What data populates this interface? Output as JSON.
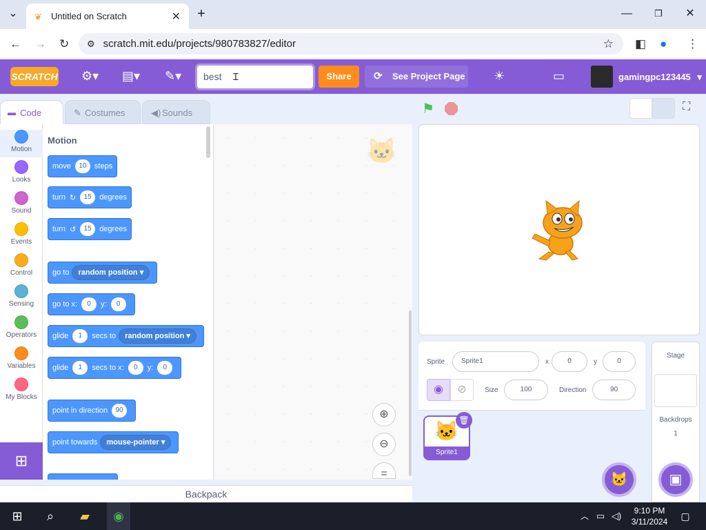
{
  "browser": {
    "tab_title": "Untitled on Scratch",
    "url": "scratch.mit.edu/projects/980783827/editor"
  },
  "menubar": {
    "logo": "SCRATCH",
    "title_value": "best",
    "share_label": "Share",
    "see_project_label": "See Project Page",
    "username": "gamingpc123445"
  },
  "tabs": {
    "code": "Code",
    "costumes": "Costumes",
    "sounds": "Sounds"
  },
  "categories": [
    {
      "label": "Motion",
      "color": "#4c97ff"
    },
    {
      "label": "Looks",
      "color": "#9966ff"
    },
    {
      "label": "Sound",
      "color": "#cf63cf"
    },
    {
      "label": "Events",
      "color": "#ffbf00"
    },
    {
      "label": "Control",
      "color": "#ffab19"
    },
    {
      "label": "Sensing",
      "color": "#5cb1d6"
    },
    {
      "label": "Operators",
      "color": "#59c059"
    },
    {
      "label": "Variables",
      "color": "#ff8c1a"
    },
    {
      "label": "My Blocks",
      "color": "#ff6680"
    }
  ],
  "palette": {
    "section_title": "Motion",
    "move": {
      "a": "move",
      "v": "10",
      "b": "steps"
    },
    "turn_right": {
      "a": "turn",
      "v": "15",
      "b": "degrees"
    },
    "turn_left": {
      "a": "turn",
      "v": "15",
      "b": "degrees"
    },
    "goto": {
      "a": "go to",
      "d": "random position"
    },
    "goto_xy": {
      "a": "go to x:",
      "x": "0",
      "b": "y:",
      "y": "0"
    },
    "glide": {
      "a": "glide",
      "v": "1",
      "b": "secs to",
      "d": "random position"
    },
    "glide_xy": {
      "a": "glide",
      "v": "1",
      "b": "secs to x:",
      "x": "0",
      "c": "y:",
      "y": "0"
    },
    "point_dir": {
      "a": "point in direction",
      "v": "90"
    },
    "point_towards": {
      "a": "point towards",
      "d": "mouse-pointer"
    }
  },
  "backpack": "Backpack",
  "sprite_info": {
    "sprite_label": "Sprite",
    "sprite_name": "Sprite1",
    "x_label": "x",
    "x": "0",
    "y_label": "y",
    "y": "0",
    "size_label": "Size",
    "size": "100",
    "direction_label": "Direction",
    "direction": "90"
  },
  "sprites": [
    {
      "name": "Sprite1"
    }
  ],
  "stage_panel": {
    "title": "Stage",
    "backdrops_label": "Backdrops",
    "backdrops_count": "1"
  },
  "taskbar": {
    "time": "9:10 PM",
    "date": "3/11/2024"
  }
}
